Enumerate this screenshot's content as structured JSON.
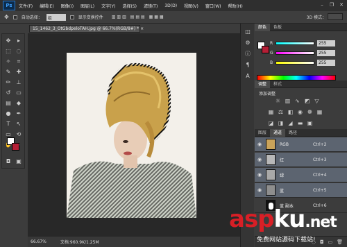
{
  "app": {
    "logo": "Ps"
  },
  "menu": [
    "文件(F)",
    "编辑(E)",
    "图像(I)",
    "图层(L)",
    "文字(Y)",
    "选择(S)",
    "滤镜(T)",
    "3D(D)",
    "视图(V)",
    "窗口(W)",
    "帮助(H)"
  ],
  "options_bar": {
    "auto_select_label": "自动选择：",
    "auto_select_value": "组",
    "show_transform_label": "显示变换控件",
    "mode_3d_label": "3D 模式："
  },
  "document": {
    "tab_title": "15_1462_3_OtGbdpeloTAH.jpg @ 66.7%(RGB/8#) *",
    "close": "×"
  },
  "status": {
    "zoom": "66.67%",
    "doc_info": "文档:960.9K/1.25M"
  },
  "color_panel": {
    "tabs": [
      "颜色",
      "色板"
    ],
    "fg": "#ffffff",
    "bg": "#b51f36",
    "sliders": [
      {
        "letter": "R",
        "value": "255"
      },
      {
        "letter": "G",
        "value": "255"
      },
      {
        "letter": "B",
        "value": "255"
      }
    ]
  },
  "adjustments_panel": {
    "tabs": [
      "调整",
      "样式"
    ],
    "title": "添加调整",
    "icons": [
      "brightness-icon",
      "levels-icon",
      "curves-icon",
      "exposure-icon",
      "vibrance-icon",
      "hue-icon",
      "balance-icon",
      "bw-icon",
      "photo-filter-icon",
      "mixer-icon",
      "lookup-icon",
      "invert-icon",
      "posterize-icon",
      "threshold-icon",
      "gradient-map-icon",
      "selective-color-icon"
    ]
  },
  "layers_panel": {
    "tabs": [
      "图层",
      "通道",
      "路径"
    ],
    "channels": [
      {
        "name": "RGB",
        "shortcut": "Ctrl+2"
      },
      {
        "name": "红",
        "shortcut": "Ctrl+3"
      },
      {
        "name": "绿",
        "shortcut": "Ctrl+4"
      },
      {
        "name": "蓝",
        "shortcut": "Ctrl+5"
      },
      {
        "name": "蓝 副本",
        "shortcut": "Ctrl+6"
      }
    ]
  },
  "watermark": {
    "logo_asp": "asp",
    "logo_ku": "ku",
    "logo_net": ".net",
    "subtitle": "免费网站源码下载站!"
  }
}
